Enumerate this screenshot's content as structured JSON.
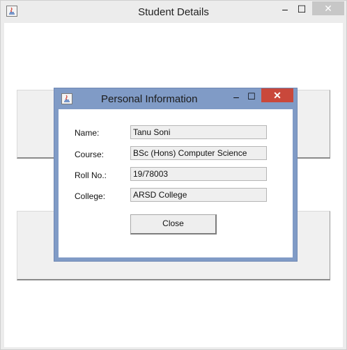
{
  "outer_window": {
    "title": "Student Details",
    "icon": "java-icon",
    "minimize": "–",
    "maximize": "☐",
    "close": "✕"
  },
  "dialog": {
    "title": "Personal Information",
    "icon": "java-icon",
    "minimize": "–",
    "maximize": "☐",
    "close": "✕",
    "fields": {
      "name_label": "Name:",
      "name_value": "Tanu Soni",
      "course_label": "Course:",
      "course_value": "BSc (Hons) Computer Science",
      "roll_label": "Roll No.:",
      "roll_value": "19/78003",
      "college_label": "College:",
      "college_value": "ARSD College"
    },
    "close_button": "Close"
  }
}
